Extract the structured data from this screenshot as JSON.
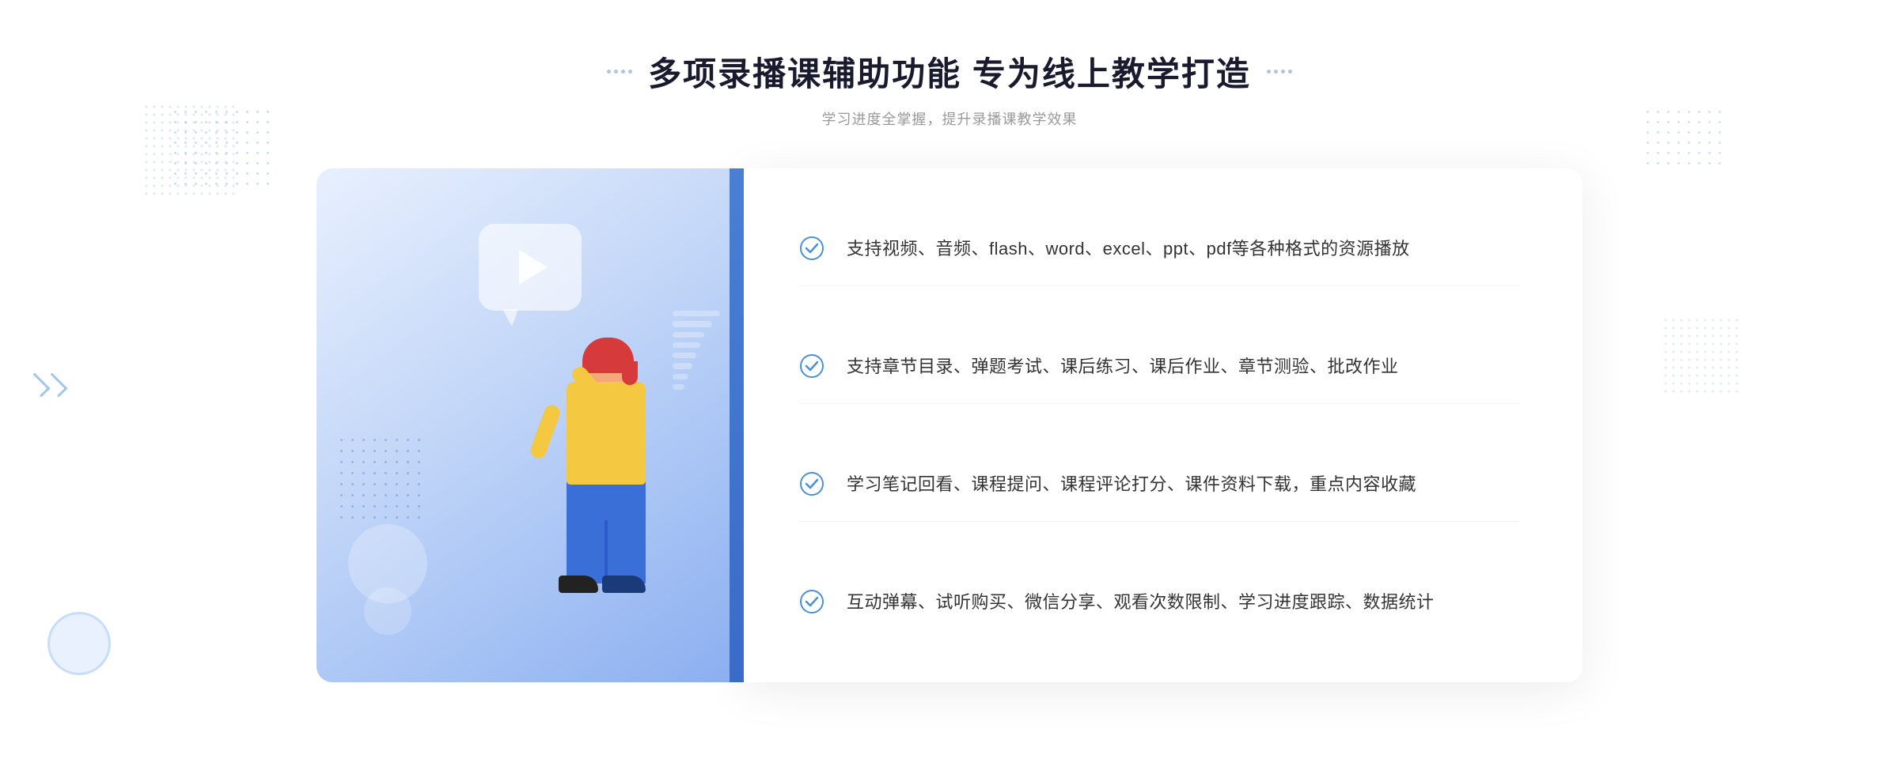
{
  "header": {
    "title": "多项录播课辅助功能 专为线上教学打造",
    "subtitle": "学习进度全掌握，提升录播课教学效果"
  },
  "features": [
    {
      "id": 1,
      "text": "支持视频、音频、flash、word、excel、ppt、pdf等各种格式的资源播放"
    },
    {
      "id": 2,
      "text": "支持章节目录、弹题考试、课后练习、课后作业、章节测验、批改作业"
    },
    {
      "id": 3,
      "text": "学习笔记回看、课程提问、课程评论打分、课件资料下载，重点内容收藏"
    },
    {
      "id": 4,
      "text": "互动弹幕、试听购买、微信分享、观看次数限制、学习进度跟踪、数据统计"
    }
  ],
  "decorative": {
    "chevron_left": "»",
    "check_color": "#4a90d9"
  }
}
